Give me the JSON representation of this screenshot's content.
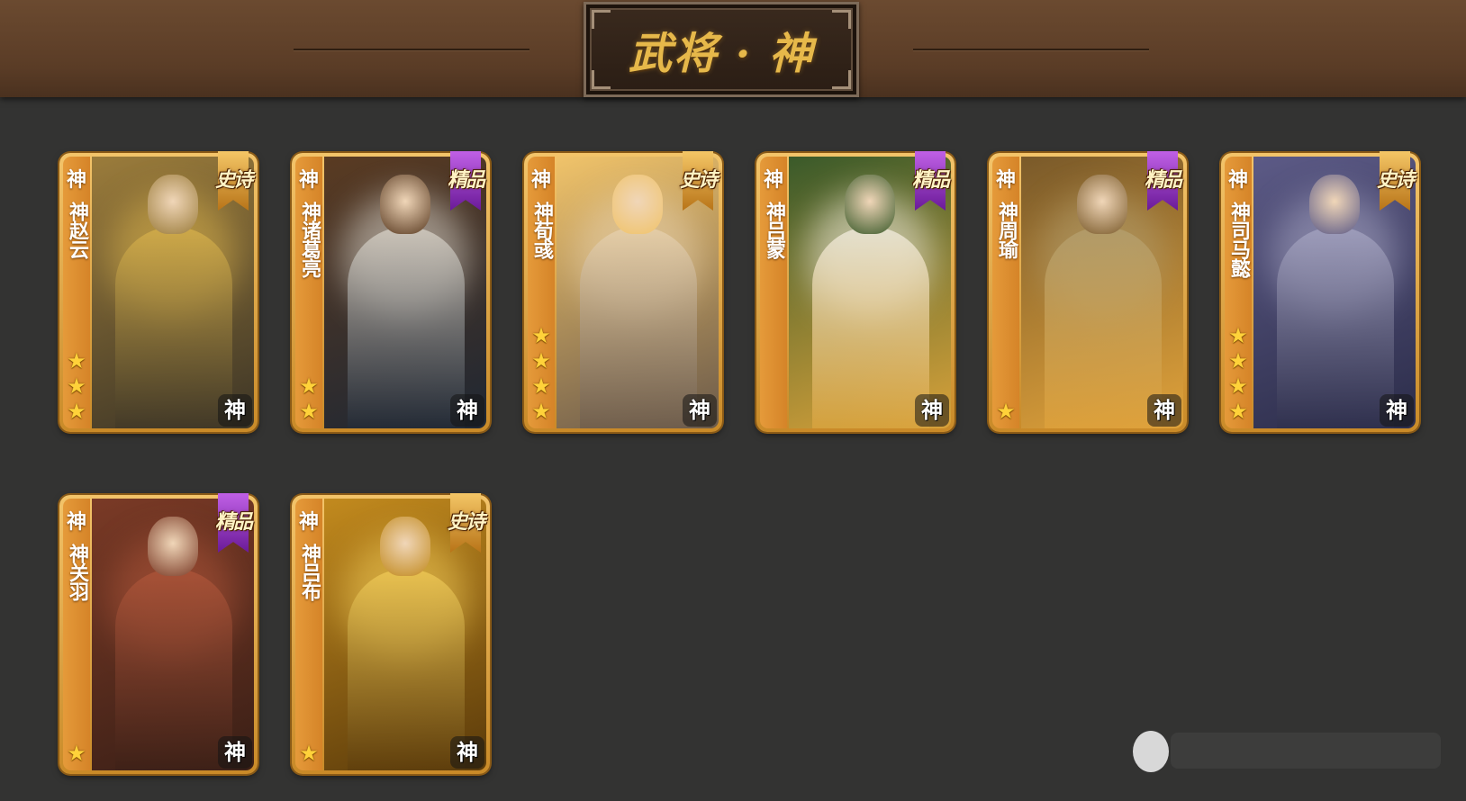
{
  "header": {
    "title": "武将 · 神"
  },
  "cards": [
    {
      "kind": "神",
      "name": "神赵云",
      "stars": 3,
      "badge": "史诗",
      "badge_type": "epic",
      "seal": "神",
      "art_colors": [
        "#3d3526",
        "#9b7c3b",
        "#d9b24c"
      ]
    },
    {
      "kind": "神",
      "name": "神诸葛亮",
      "stars": 2,
      "badge": "精品",
      "badge_type": "fine",
      "seal": "神",
      "art_colors": [
        "#1f2733",
        "#5a3b22",
        "#dcd6cb"
      ]
    },
    {
      "kind": "神",
      "name": "神荀彧",
      "stars": 4,
      "badge": "史诗",
      "badge_type": "epic",
      "seal": "神",
      "art_colors": [
        "#6b5a4a",
        "#f0c36a",
        "#e9d3b0"
      ]
    },
    {
      "kind": "神",
      "name": "神吕蒙",
      "stars": 0,
      "badge": "精品",
      "badge_type": "fine",
      "seal": "神",
      "art_colors": [
        "#d9a23a",
        "#3a5a2a",
        "#f4efe3"
      ]
    },
    {
      "kind": "神",
      "name": "神周瑜",
      "stars": 1,
      "badge": "精品",
      "badge_type": "fine",
      "seal": "神",
      "art_colors": [
        "#e0a23a",
        "#7a5a2a",
        "#b4a070"
      ]
    },
    {
      "kind": "神",
      "name": "神司马懿",
      "stars": 4,
      "badge": "史诗",
      "badge_type": "epic",
      "seal": "神",
      "art_colors": [
        "#2c2d4a",
        "#5c5a86",
        "#a8a7c4"
      ]
    },
    {
      "kind": "神",
      "name": "神关羽",
      "stars": 1,
      "badge": "精品",
      "badge_type": "fine",
      "seal": "神",
      "art_colors": [
        "#3a1f16",
        "#7a3a26",
        "#b0563a"
      ]
    },
    {
      "kind": "神",
      "name": "神吕布",
      "stars": 1,
      "badge": "史诗",
      "badge_type": "epic",
      "seal": "神",
      "art_colors": [
        "#5a3a0a",
        "#c28a1e",
        "#f2cc58"
      ]
    }
  ]
}
